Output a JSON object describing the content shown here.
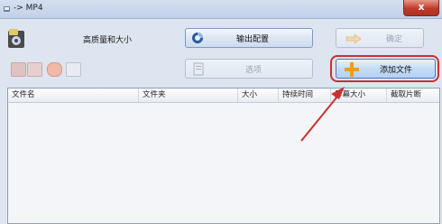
{
  "window": {
    "title": "-> MP4",
    "close_label": "x"
  },
  "toolbar": {
    "quality_label": "高质量和大小",
    "output_config_label": "输出配置",
    "confirm_label": "确定",
    "options_label": "选项",
    "add_file_label": "添加文件"
  },
  "file_list": {
    "columns": [
      "文件名",
      "文件夹",
      "大小",
      "持续时间",
      "屏幕大小",
      "截取片断"
    ]
  },
  "colors": {
    "highlight": "#c8322c",
    "add_icon": "#f29a1e"
  }
}
